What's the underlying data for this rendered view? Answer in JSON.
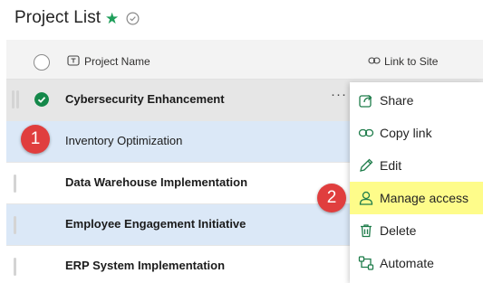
{
  "header": {
    "title": "Project List"
  },
  "columns": [
    {
      "label": "Project Name",
      "icon": "text-field-icon"
    },
    {
      "label": "Link to Site",
      "icon": "link-icon"
    }
  ],
  "rows": [
    {
      "name": "Cybersecurity Enhancement",
      "selected": true
    },
    {
      "name": "Inventory Optimization",
      "selected": false
    },
    {
      "name": "Data Warehouse Implementation",
      "selected": false
    },
    {
      "name": "Employee Engagement Initiative",
      "selected": false
    },
    {
      "name": "ERP System Implementation",
      "selected": false
    }
  ],
  "row_actions_label": "···",
  "context_menu": {
    "items": [
      {
        "label": "Share",
        "icon": "share-icon"
      },
      {
        "label": "Copy link",
        "icon": "link-icon"
      },
      {
        "label": "Edit",
        "icon": "pencil-icon"
      },
      {
        "label": "Manage access",
        "icon": "person-icon",
        "highlighted": true
      },
      {
        "label": "Delete",
        "icon": "trash-icon"
      },
      {
        "label": "Automate",
        "icon": "flow-icon"
      }
    ]
  },
  "annotations": [
    {
      "label": "1"
    },
    {
      "label": "2"
    }
  ],
  "colors": {
    "accent_green": "#14884a",
    "row_highlight": "#dbe8f7",
    "selected_row": "#e6e6e6",
    "menu_highlight": "#fefc8a",
    "badge_red": "#e03e3e"
  }
}
